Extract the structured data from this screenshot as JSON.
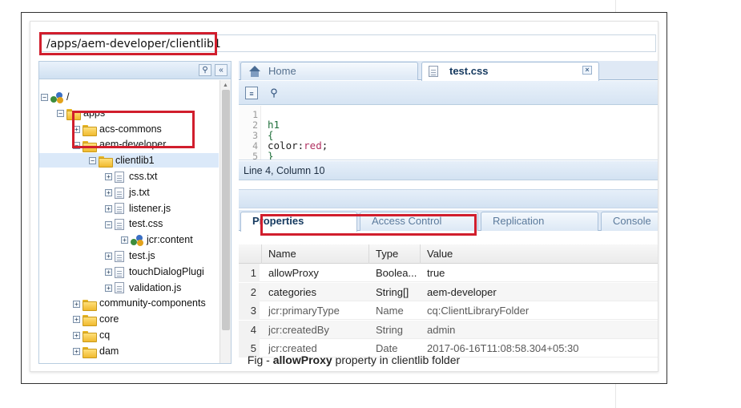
{
  "path_bar": {
    "value": "/apps/aem-developer/clientlib1"
  },
  "tree": {
    "header_icons": [
      "binoculars-icon",
      "collapse-left-icon"
    ],
    "nodes": [
      {
        "label": "/",
        "toggle": "−",
        "icon": "network-icon"
      },
      {
        "label": "apps",
        "toggle": "−",
        "icon": "folder-icon"
      },
      {
        "label": "acs-commons",
        "toggle": "+",
        "icon": "folder-icon"
      },
      {
        "label": "aem-developer",
        "toggle": "−",
        "icon": "folder-icon"
      },
      {
        "label": "clientlib1",
        "toggle": "−",
        "icon": "folder-icon"
      },
      {
        "label": "css.txt",
        "toggle": "+",
        "icon": "file-icon"
      },
      {
        "label": "js.txt",
        "toggle": "+",
        "icon": "file-icon"
      },
      {
        "label": "listener.js",
        "toggle": "+",
        "icon": "file-icon"
      },
      {
        "label": "test.css",
        "toggle": "−",
        "icon": "file-icon"
      },
      {
        "label": "jcr:content",
        "toggle": "+",
        "icon": "network-icon"
      },
      {
        "label": "test.js",
        "toggle": "+",
        "icon": "file-icon"
      },
      {
        "label": "touchDialogPlugi",
        "toggle": "+",
        "icon": "file-icon"
      },
      {
        "label": "validation.js",
        "toggle": "+",
        "icon": "file-icon"
      },
      {
        "label": "community-components",
        "toggle": "+",
        "icon": "folder-icon"
      },
      {
        "label": "core",
        "toggle": "+",
        "icon": "folder-icon"
      },
      {
        "label": "cq",
        "toggle": "+",
        "icon": "folder-icon"
      },
      {
        "label": "dam",
        "toggle": "+",
        "icon": "folder-icon"
      }
    ]
  },
  "editor_tabs": [
    {
      "label": "Home",
      "icon": "home-icon"
    },
    {
      "label": "test.css",
      "icon": "file-icon",
      "close": "×"
    }
  ],
  "editor": {
    "lines": [
      {
        "n": "1",
        "text": ""
      },
      {
        "n": "2",
        "text": "h1"
      },
      {
        "n": "3",
        "text": "{"
      },
      {
        "n": "4",
        "prop": "color:",
        "val": "red",
        "end": ";"
      },
      {
        "n": "5",
        "text": "}"
      }
    ],
    "status": "Line 4, Column 10"
  },
  "properties_tabs": [
    "Properties",
    "Access Control",
    "Replication",
    "Console"
  ],
  "properties_table": {
    "columns": [
      "Name",
      "Type",
      "Value"
    ],
    "rows": [
      {
        "n": "1",
        "name": "allowProxy",
        "type": "Boolea...",
        "value": "true"
      },
      {
        "n": "2",
        "name": "categories",
        "type": "String[]",
        "value": "aem-developer"
      },
      {
        "n": "3",
        "name": "jcr:primaryType",
        "type": "Name",
        "value": "cq:ClientLibraryFolder"
      },
      {
        "n": "4",
        "name": "jcr:createdBy",
        "type": "String",
        "value": "admin"
      },
      {
        "n": "5",
        "name": "jcr:created",
        "type": "Date",
        "value": "2017-06-16T11:08:58.304+05:30"
      }
    ]
  },
  "caption": {
    "prefix": "Fig - ",
    "bold": "allowProxy",
    "suffix": " property in clientlib folder"
  },
  "colors": {
    "highlight_red": "#d11e2d",
    "selected_node": "#dbe9f9",
    "tab_text": "#15395f"
  }
}
